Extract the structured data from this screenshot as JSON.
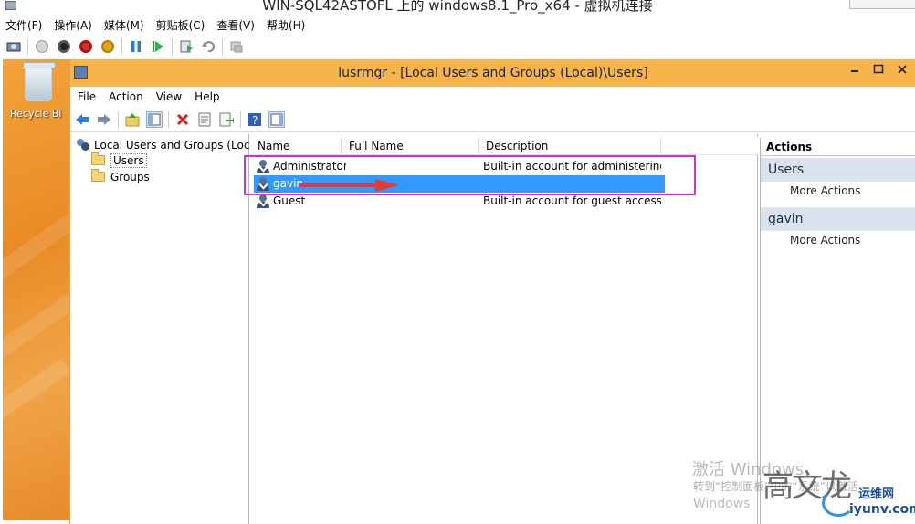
{
  "vm_window": {
    "title": "WIN-SQL42ASTOFL 上的 windows8.1_Pro_x64 - 虚拟机连接",
    "menu": [
      "文件(F)",
      "操作(A)",
      "媒体(M)",
      "剪贴板(C)",
      "查看(V)",
      "帮助(H)"
    ]
  },
  "desktop": {
    "recycle_bin_label": "Recycle Bi"
  },
  "mmc": {
    "title": "lusrmgr - [Local Users and Groups (Local)\\Users]",
    "menu": [
      "File",
      "Action",
      "View",
      "Help"
    ],
    "tree": {
      "root": "Local Users and Groups (Local)",
      "children": [
        "Users",
        "Groups"
      ],
      "selected": "Users"
    },
    "list": {
      "columns": [
        "Name",
        "Full Name",
        "Description"
      ],
      "rows": [
        {
          "name": "Administrator",
          "full_name": "",
          "description": "Built-in account for administering..."
        },
        {
          "name": "gavin",
          "full_name": "",
          "description": ""
        },
        {
          "name": "Guest",
          "full_name": "",
          "description": "Built-in account for guest access t..."
        }
      ],
      "selected_row": "gavin"
    },
    "actions": {
      "header": "Actions",
      "groups": [
        {
          "title": "Users",
          "item": "More Actions"
        },
        {
          "title": "gavin",
          "item": "More Actions"
        }
      ]
    }
  },
  "watermark": {
    "line1": "激活 Windows",
    "line2": "转到“控制面板”中的“系统”以激活",
    "line3": "Windows",
    "stamp": "高文龙",
    "site1": "运维网",
    "site2": "iyunv.com"
  },
  "colors": {
    "selection": "#3399ff",
    "highlight_box": "#cc33cc",
    "annotation_arrow": "#e53935",
    "mmc_titlebar": "#f7b44b"
  }
}
